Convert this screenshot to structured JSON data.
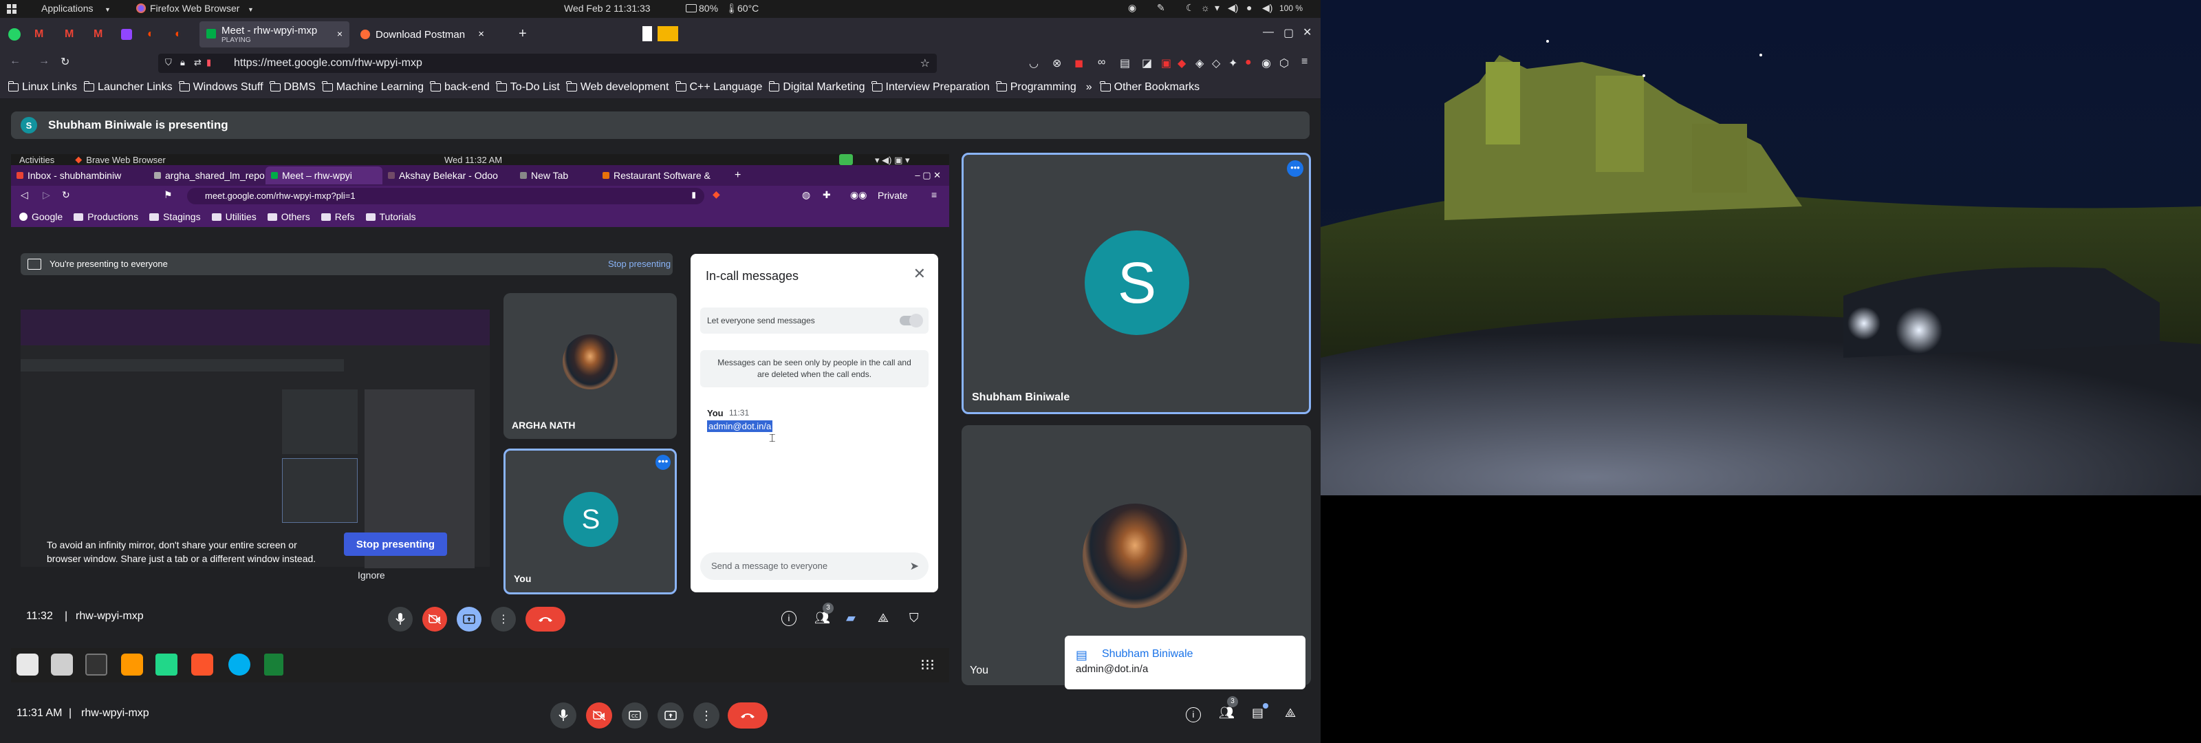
{
  "system_bar": {
    "applications": "Applications",
    "browser_menu": "Firefox Web Browser",
    "datetime": "Wed Feb 2  11:31:33",
    "battery": "80%",
    "temperature": "60°C",
    "volume": "100 %"
  },
  "browser": {
    "tabs": [
      {
        "title": "Meet - rhw-wpyi-mxp",
        "subtitle": "PLAYING",
        "active": true
      },
      {
        "title": "Download Postman",
        "active": false
      }
    ],
    "url": "https://meet.google.com/rhw-wpyi-mxp",
    "bookmarks": [
      "Linux Links",
      "Launcher Links",
      "Windows Stuff",
      "DBMS",
      "Machine Learning",
      "back-end",
      "To-Do List",
      "Web development",
      "C++ Language",
      "Digital Marketing",
      "Interview Preparation",
      "Programming"
    ],
    "other_bookmarks": "Other Bookmarks"
  },
  "meet": {
    "presenting_banner": "Shubham Biniwale is presenting",
    "presenter_initial": "S",
    "meeting_time": "11:32",
    "meeting_code": "rhw-wpyi-mxp",
    "tiles": [
      {
        "name": "Shubham Biniwale",
        "initial": "S"
      },
      {
        "name": "You"
      }
    ],
    "participants_count": "3",
    "toast": {
      "sender": "Shubham Biniwale",
      "message": "admin@dot.in/a"
    }
  },
  "shared_screen": {
    "activities": "Activities",
    "browser_menu": "Brave Web Browser",
    "datetime": "Wed 11:32 AM",
    "tabs": [
      "Inbox - shubhambiniw",
      "argha_shared_lm_repo",
      "Meet – rhw-wpyi",
      "Akshay Belekar - Odoo",
      "New Tab",
      "Restaurant Software &"
    ],
    "url": "meet.google.com/rhw-wpyi-mxp?pli=1",
    "private_label": "Private",
    "bookmarks": [
      "Google",
      "Productions",
      "Stagings",
      "Utilities",
      "Others",
      "Refs",
      "Tutorials"
    ],
    "presenting_to": "You're presenting to everyone",
    "stop_presenting_link": "Stop presenting",
    "mirror_warning": "To avoid an infinity mirror, don't share your entire screen or browser window. Share just a tab or a different window instead.",
    "stop_presenting_button": "Stop presenting",
    "ignore": "Ignore",
    "tiles": [
      {
        "name": "ARGHA NATH"
      },
      {
        "name": "You",
        "initial": "S"
      }
    ],
    "messages_panel": {
      "title": "In-call messages",
      "toggle_label": "Let everyone send messages",
      "notice": "Messages can be seen only by people in the call and are deleted when the call ends.",
      "sender": "You",
      "time": "11:31",
      "message": "admin@dot.in/a",
      "input_placeholder": "Send a message to everyone"
    },
    "meeting_time": "11:32",
    "meeting_code": "rhw-wpyi-mxp",
    "participants_count": "3"
  },
  "host_bottom": {
    "time": "11:31 AM",
    "meeting_code": "rhw-wpyi-mxp",
    "participants_count": "3"
  },
  "colors": {
    "meet_bg": "#202124",
    "tile_bg": "#3c4043",
    "avatar_teal": "#12939e",
    "hangup_red": "#ea4335",
    "present_blue": "#8ab4f8",
    "brave_purple": "#4a1d68"
  }
}
